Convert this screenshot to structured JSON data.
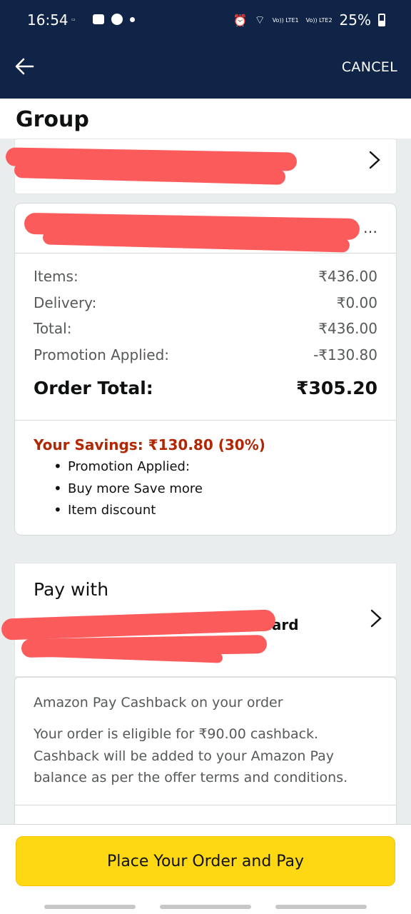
{
  "status_bar": {
    "time": "16:54",
    "battery": "25%",
    "sim1": "Vo)) LTE1",
    "sim2": "Vo)) LTE2"
  },
  "app_bar": {
    "back_icon": "arrow-left-icon",
    "cancel_label": "CANCEL"
  },
  "group": {
    "title": "Group"
  },
  "order": {
    "ellipsis": "…",
    "rows": [
      {
        "label": "Items:",
        "value": "₹436.00"
      },
      {
        "label": "Delivery:",
        "value": "₹0.00"
      },
      {
        "label": "Total:",
        "value": "₹436.00"
      },
      {
        "label": "Promotion Applied:",
        "value": "-₹130.80"
      }
    ],
    "order_total_label": "Order Total:",
    "order_total_value": "₹305.20",
    "savings": "Your Savings: ₹130.80 (30%)",
    "savings_items": [
      "Promotion Applied:",
      "Buy more Save more",
      "Item discount"
    ]
  },
  "payment": {
    "title": "Pay with",
    "method_visible": "card"
  },
  "cashback": {
    "title": "Amazon Pay Cashback on your order",
    "body": "Your order is eligible for ₹90.00 cashback. Cashback will be added to your Amazon Pay balance as per the offer terms and conditions."
  },
  "cta": {
    "label": "Place Your Order and Pay"
  },
  "colors": {
    "header_bg": "#0f2447",
    "cta_bg": "#ffd814",
    "savings_text": "#b12704",
    "redaction": "#fb5b5b"
  }
}
